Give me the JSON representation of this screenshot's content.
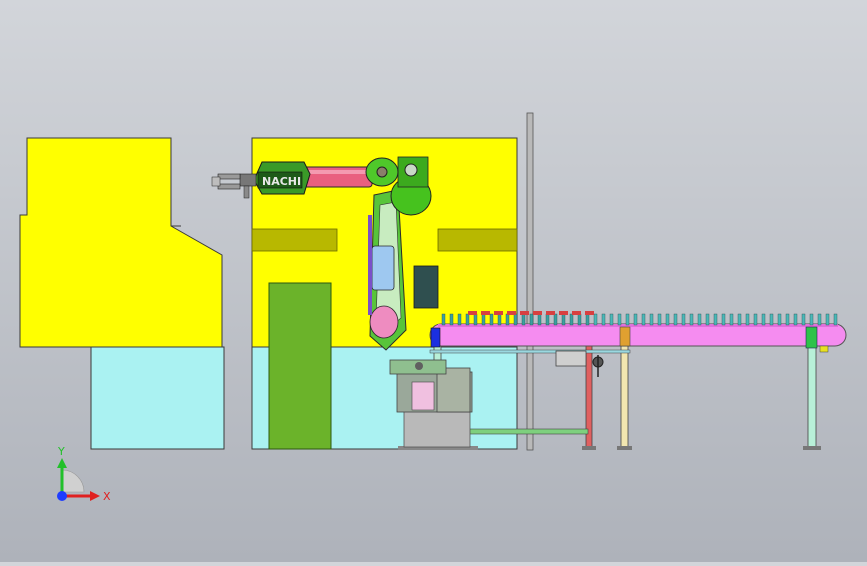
{
  "viewport": {
    "background_top": "#d2d5da",
    "background_bottom": "#aeb2ba"
  },
  "colors": {
    "machine_yellow": "#ffff00",
    "guard_cyan": "#aaf2f2",
    "door_green": "#6bb32a",
    "robot_pink": "#e9607f",
    "robot_green": "#46c21e",
    "conveyor_magenta": "#f58cf0",
    "outline": "#3a3a3a"
  },
  "robot": {
    "brand_label": "NACHI"
  },
  "triad": {
    "y_label": "Y",
    "x_label": "X",
    "y_color": "#22c02a",
    "x_color": "#e02020",
    "z_color": "#1e3cff"
  }
}
